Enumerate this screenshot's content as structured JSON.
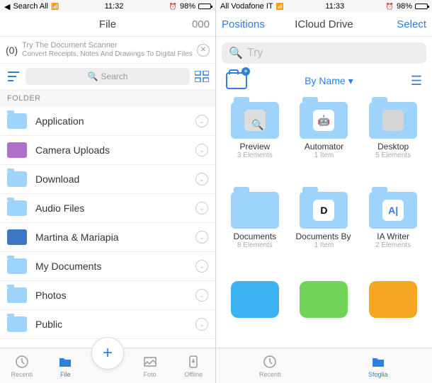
{
  "left": {
    "status": {
      "carrier": "Search All",
      "time": "11:32",
      "battery": "98%"
    },
    "nav": {
      "left": "",
      "title": "File",
      "right": "000"
    },
    "banner": {
      "badge": "(0)",
      "title": "Try The Document Scanner",
      "subtitle": "Convert Receipts, Notes And Drawings To Digital Files"
    },
    "search_placeholder": "Search",
    "section": "FOLDER",
    "folders": [
      {
        "name": "Application",
        "style": "blue"
      },
      {
        "name": "Camera Uploads",
        "style": "purple"
      },
      {
        "name": "Download",
        "style": "blue"
      },
      {
        "name": "Audio Files",
        "style": "blue"
      },
      {
        "name": "Martina & Mariapia",
        "style": "darkblue"
      },
      {
        "name": "My Documents",
        "style": "blue"
      },
      {
        "name": "Photos",
        "style": "blue"
      },
      {
        "name": "Public",
        "style": "blue"
      }
    ],
    "tabs": [
      {
        "label": "Recenti",
        "active": false
      },
      {
        "label": "File",
        "active": true
      },
      {
        "label": "Foto",
        "active": false
      },
      {
        "label": "Offline",
        "active": false
      }
    ]
  },
  "right": {
    "status": {
      "carrier": "All Vodafone IT",
      "time": "11:33",
      "battery": "98%"
    },
    "nav": {
      "left": "Positions",
      "title": "ICloud Drive",
      "right": "Select"
    },
    "search_value": "Try",
    "sort_label": "By Name",
    "items": [
      {
        "name": "Preview",
        "meta": "3 Elements",
        "icon": "preview"
      },
      {
        "name": "Automator",
        "meta": "1 Item",
        "icon": "automator"
      },
      {
        "name": "Desktop",
        "meta": "5 Elements",
        "icon": "desktop"
      },
      {
        "name": "Documents",
        "meta": "8 Elements",
        "icon": "blank"
      },
      {
        "name": "Documents By Readdle",
        "meta": "1 Item",
        "icon": "readdle"
      },
      {
        "name": "IA Writer",
        "meta": "2 Elements",
        "icon": "iawriter"
      }
    ],
    "tabs": [
      {
        "label": "Recenti",
        "active": false
      },
      {
        "label": "Sfoglia",
        "active": true
      }
    ]
  }
}
